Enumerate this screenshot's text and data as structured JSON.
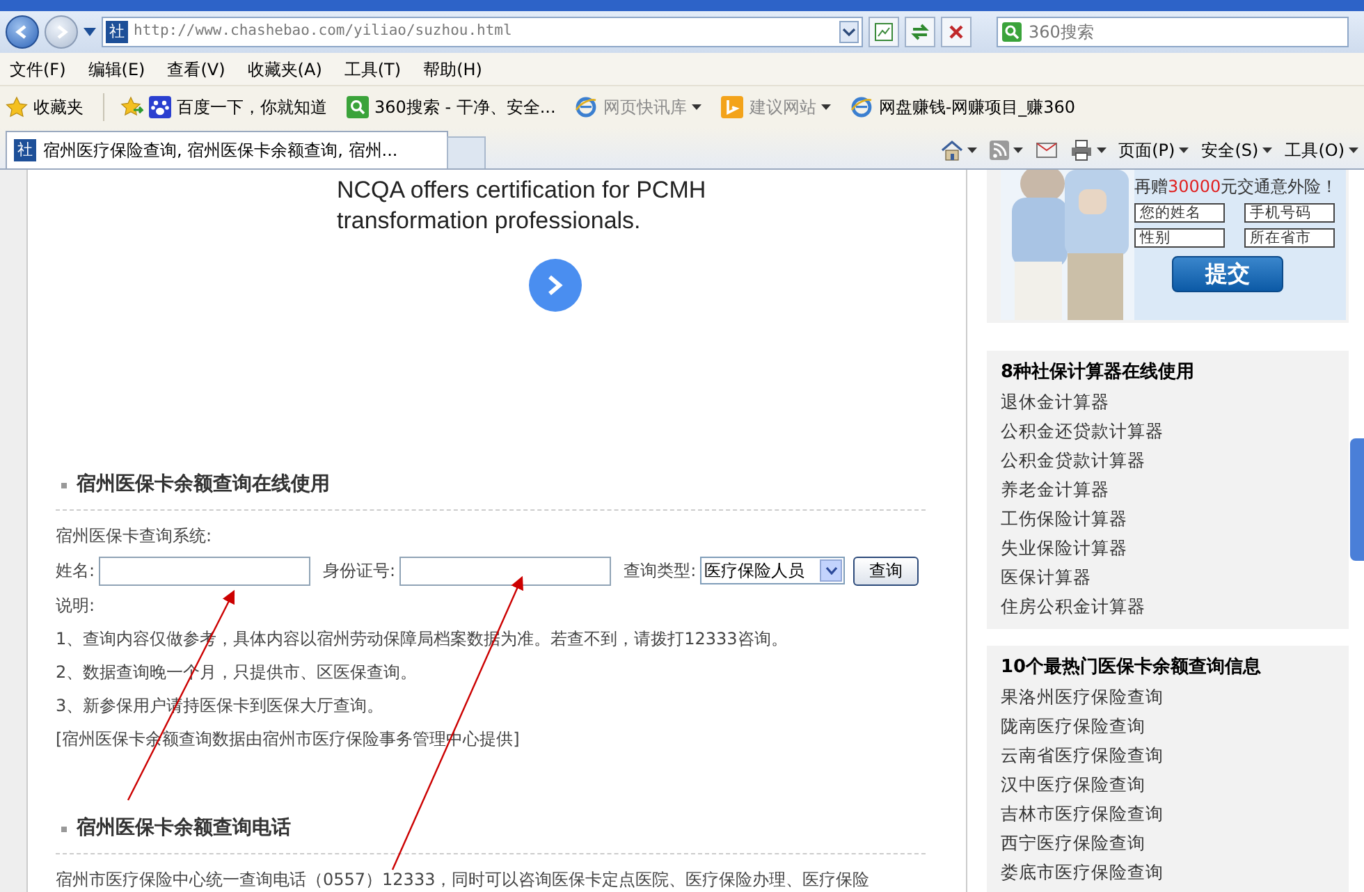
{
  "address_bar": {
    "favicon": "社",
    "url": "http://www.chashebao.com/yiliao/suzhou.html",
    "search_placeholder": "360搜索"
  },
  "menu": [
    "文件(F)",
    "编辑(E)",
    "查看(V)",
    "收藏夹(A)",
    "工具(T)",
    "帮助(H)"
  ],
  "favorites_bar": {
    "label": "收藏夹",
    "items": [
      {
        "label": "百度一下，你就知道",
        "disabled": false,
        "dropdown": false
      },
      {
        "label": "360搜索 - 干净、安全...",
        "disabled": false,
        "dropdown": false
      },
      {
        "label": "网页快讯库",
        "disabled": true,
        "dropdown": true
      },
      {
        "label": "建议网站",
        "disabled": true,
        "dropdown": true
      },
      {
        "label": "网盘赚钱-网赚项目_赚360",
        "disabled": false,
        "dropdown": false
      }
    ]
  },
  "tabs": [
    {
      "kind": "page",
      "favicon": "社",
      "label": "宿州医疗保险查询, 宿州医保卡余额查询, 宿州...",
      "selected": true
    },
    {
      "kind": "new",
      "selected": false
    }
  ],
  "command_bar": [
    "页面(P)",
    "安全(S)",
    "工具(O)"
  ],
  "ad": {
    "text": "NCQA offers certification for PCMH transformation professionals."
  },
  "query_section": {
    "heading": "宿州医保卡余额查询在线使用",
    "system_label": "宿州医保卡查询系统:",
    "fields": [
      {
        "label": "姓名:"
      },
      {
        "label": "身份证号:"
      }
    ],
    "type_label": "查询类型:",
    "type_value": "医疗保险人员",
    "button": "查询",
    "notes_title": "说明:",
    "notes": [
      "1、查询内容仅做参考，具体内容以宿州劳动保障局档案数据为准。若查不到，请拨打12333咨询。",
      "2、数据查询晚一个月，只提供市、区医保查询。",
      "3、新参保用户请持医保卡到医保大厅查询。"
    ],
    "source": "[宿州医保卡余额查询数据由宿州市医疗保险事务管理中心提供]"
  },
  "phone_section": {
    "heading": "宿州医保卡余额查询电话",
    "text": "宿州市医疗保险中心统一查询电话（0557）12333，同时可以咨询医保卡定点医院、医疗保险办理、医疗保险"
  },
  "side_ad": {
    "kind": "picture",
    "headline_before": "再赠",
    "headline_highlight": "30000",
    "headline_after": "元交通意外险！",
    "fields": [
      "您的姓名",
      "手机号码",
      "性别",
      "所在省市"
    ],
    "button": "提交"
  },
  "calculators": {
    "title": "8种社保计算器在线使用",
    "items": [
      "退休金计算器",
      "公积金还贷款计算器",
      "公积金贷款计算器",
      "养老金计算器",
      "工伤保险计算器",
      "失业保险计算器",
      "医保计算器",
      "住房公积金计算器"
    ]
  },
  "hot_queries": {
    "title": "10个最热门医保卡余额查询信息",
    "items": [
      "果洛州医疗保险查询",
      "陇南医疗保险查询",
      "云南省医疗保险查询",
      "汉中医疗保险查询",
      "吉林市医疗保险查询",
      "西宁医疗保险查询",
      "娄底市医疗保险查询"
    ]
  }
}
